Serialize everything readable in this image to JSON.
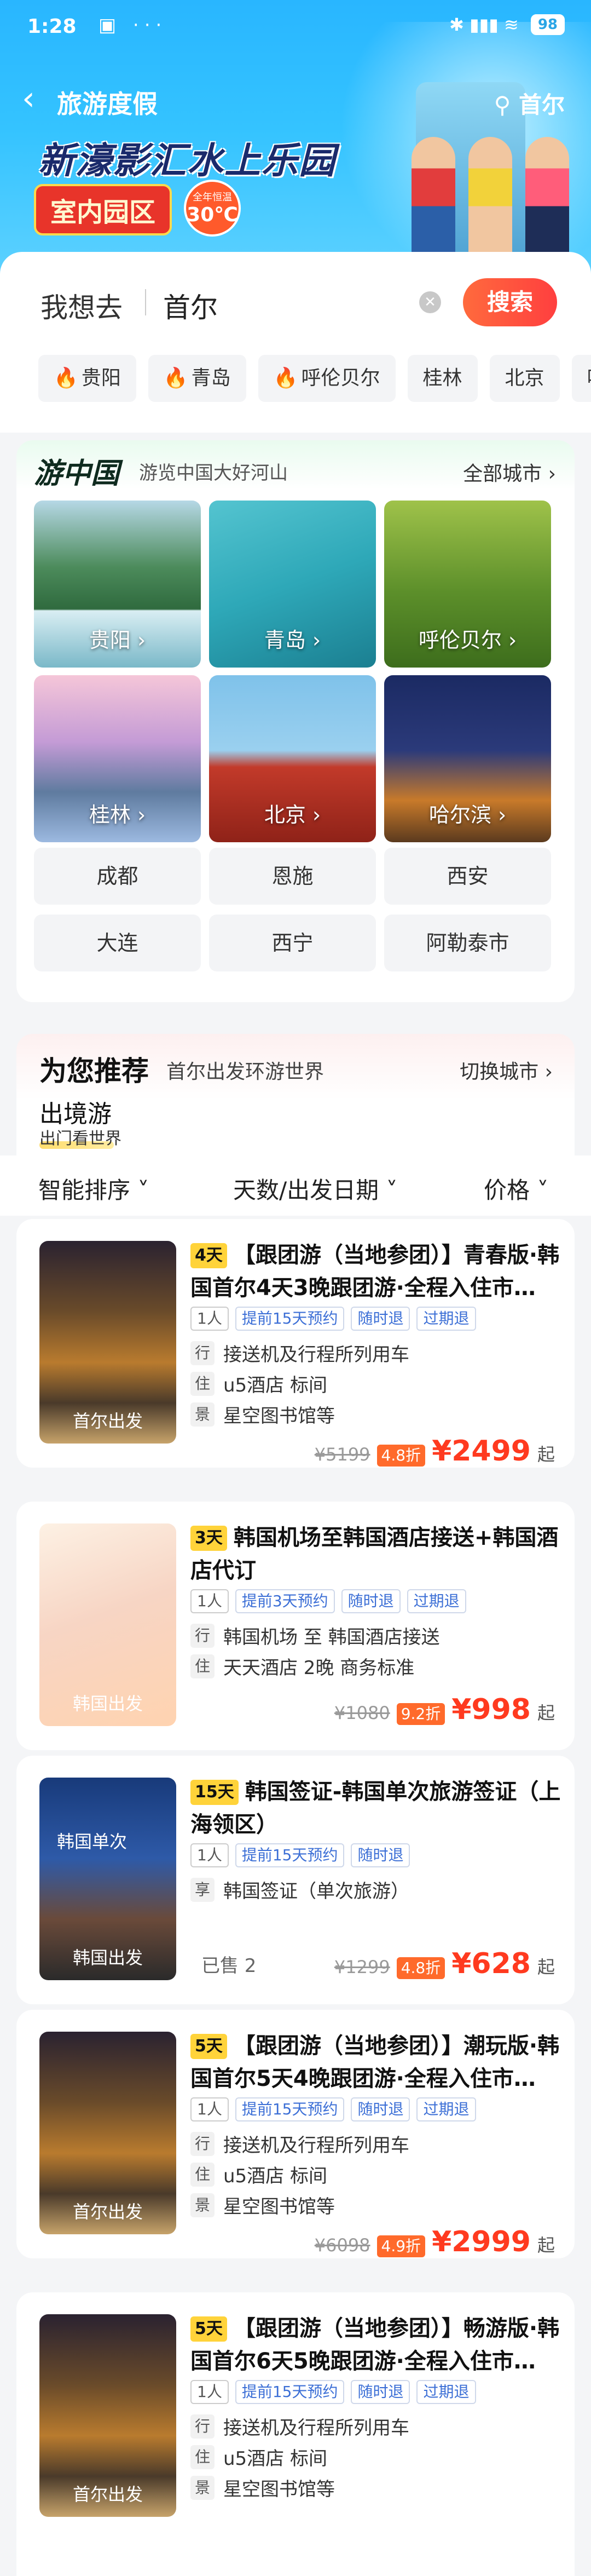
{
  "status_bar": {
    "time": "1:28",
    "icons": "▣ ···",
    "right_icons": "✱ ▮▮▮ ≋",
    "battery": "98"
  },
  "nav": {
    "title": "旅游度假",
    "location": "首尔"
  },
  "banner": {
    "headline": "新濠影汇水上乐园",
    "tag": "室内园区",
    "temp_caption": "全年恒温",
    "temp_value": "30℃"
  },
  "search": {
    "label": "我想去",
    "value": "首尔",
    "button": "搜索",
    "chips": [
      {
        "label": "贵阳",
        "hot": true
      },
      {
        "label": "青岛",
        "hot": true
      },
      {
        "label": "呼伦贝尔",
        "hot": true
      },
      {
        "label": "桂林",
        "hot": false
      },
      {
        "label": "北京",
        "hot": false
      },
      {
        "label": "哈",
        "hot": false
      }
    ]
  },
  "china": {
    "title": "游中国",
    "subtitle": "游览中国大好河山",
    "more": "全部城市 ›",
    "cities": [
      "贵阳 ›",
      "青岛 ›",
      "呼伦贝尔 ›",
      "桂林 ›",
      "北京 ›",
      "哈尔滨 ›"
    ],
    "buttons": [
      "成都",
      "恩施",
      "西安",
      "大连",
      "西宁",
      "阿勒泰市"
    ]
  },
  "recommend": {
    "title": "为您推荐",
    "subtitle": "首尔出发环游世界",
    "switch": "切换城市 ›",
    "tab": "出境游",
    "tab_sub": "出门看世界"
  },
  "sort": {
    "s1": "智能排序 ˅",
    "s2": "天数/出发日期 ˅",
    "s3": "价格 ˅"
  },
  "products": [
    {
      "days": "4天",
      "title": "【跟团游（当地参团）】青春版·韩国首尔4天3晚跟团游·全程入住市…",
      "badge": "首尔出发",
      "tags": [
        "1人",
        "提前15天预约",
        "随时退",
        "过期退"
      ],
      "info": [
        {
          "icon": "行",
          "text": "接送机及行程所列用车"
        },
        {
          "icon": "住",
          "text": "u5酒店 标间"
        },
        {
          "icon": "景",
          "text": "星空图书馆等"
        }
      ],
      "orig": "¥5199",
      "disc": "4.8折",
      "price": "¥2499",
      "suffix": "起"
    },
    {
      "days": "3天",
      "title": "韩国机场至韩国酒店接送+韩国酒店代订",
      "badge": "韩国出发",
      "tags": [
        "1人",
        "提前3天预约",
        "随时退",
        "过期退"
      ],
      "info": [
        {
          "icon": "行",
          "text": "韩国机场 至 韩国酒店接送"
        },
        {
          "icon": "住",
          "text": "天天酒店 2晚  商务标准"
        }
      ],
      "orig": "¥1080",
      "disc": "9.2折",
      "price": "¥998",
      "suffix": "起"
    },
    {
      "days": "15天",
      "title": "韩国签证-韩国单次旅游签证（上海领区）",
      "badge": "韩国出发",
      "overtext": "韩国单次",
      "tags": [
        "1人",
        "提前15天预约",
        "随时退"
      ],
      "info": [
        {
          "icon": "享",
          "text": "韩国签证（单次旅游）"
        }
      ],
      "sold": "已售 2",
      "orig": "¥1299",
      "disc": "4.8折",
      "price": "¥628",
      "suffix": "起"
    },
    {
      "days": "5天",
      "title": "【跟团游（当地参团）】潮玩版·韩国首尔5天4晚跟团游·全程入住市…",
      "badge": "首尔出发",
      "tags": [
        "1人",
        "提前15天预约",
        "随时退",
        "过期退"
      ],
      "info": [
        {
          "icon": "行",
          "text": "接送机及行程所列用车"
        },
        {
          "icon": "住",
          "text": "u5酒店 标间"
        },
        {
          "icon": "景",
          "text": "星空图书馆等"
        }
      ],
      "orig": "¥6098",
      "disc": "4.9折",
      "price": "¥2999",
      "suffix": "起"
    },
    {
      "days": "5天",
      "title": "【跟团游（当地参团）】畅游版·韩国首尔6天5晚跟团游·全程入住市…",
      "badge": "首尔出发",
      "tags": [
        "1人",
        "提前15天预约",
        "随时退",
        "过期退"
      ],
      "info": [
        {
          "icon": "行",
          "text": "接送机及行程所列用车"
        },
        {
          "icon": "住",
          "text": "u5酒店 标间"
        },
        {
          "icon": "景",
          "text": "星空图书馆等"
        }
      ],
      "orig": "",
      "disc": "",
      "price": "",
      "suffix": ""
    }
  ]
}
